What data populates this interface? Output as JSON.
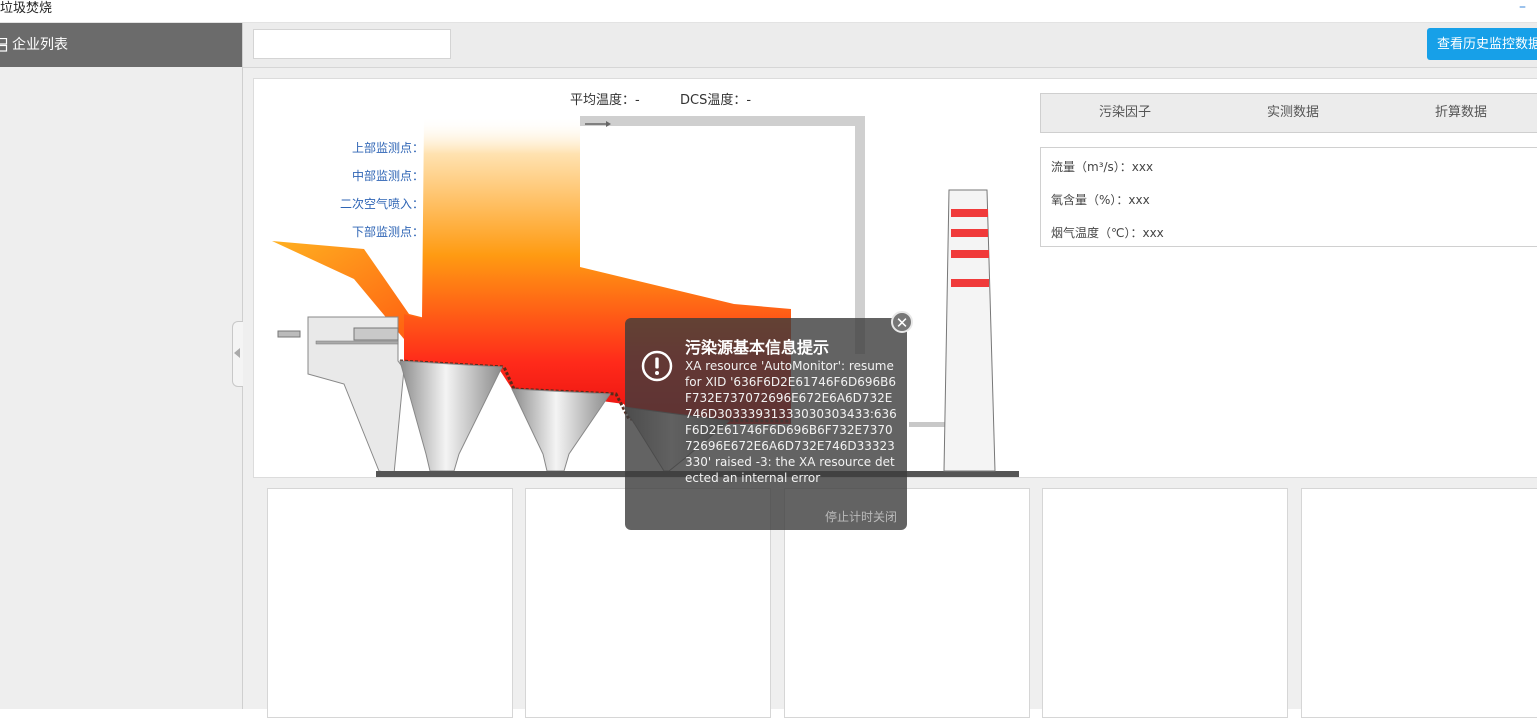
{
  "app": {
    "title": "垃圾焚烧",
    "minimize": "–"
  },
  "sidebar": {
    "title": "企业列表"
  },
  "toolbar": {
    "search_value": "",
    "history_button": "查看历史监控数据"
  },
  "diagram": {
    "avg_temp_label": "平均温度：-",
    "dcs_temp_label": "DCS温度：-",
    "probes": {
      "upper": "上部监测点：",
      "middle": "中部监测点：",
      "secondary_air": "二次空气喷入：",
      "lower": "下部监测点："
    }
  },
  "tabs": [
    {
      "label": "污染因子"
    },
    {
      "label": "实测数据"
    },
    {
      "label": "折算数据"
    }
  ],
  "data_rows": [
    {
      "label": "流量（m³/s）：xxx"
    },
    {
      "label": "氧含量（%）：xxx"
    },
    {
      "label": "烟气温度（℃）：xxx"
    }
  ],
  "dialog": {
    "title": "污染源基本信息提示",
    "message": "XA resource 'AutoMonitor': resume for XID '636F6D2E61746F6D696B6F732E737072696E672E6A6D732E746D30333931333030303433:636F6D2E61746F6D696B6F732E737072696E672E6A6D732E746D33323330' raised -3: the XA resource detected an internal error",
    "stop_label": "停止计时关闭",
    "close": "✕"
  },
  "colors": {
    "accent": "#17a0e8",
    "sidebar_header": "#6b6b6b",
    "probe_text": "#2f65b5",
    "stack_stripe": "#f03a3a"
  }
}
